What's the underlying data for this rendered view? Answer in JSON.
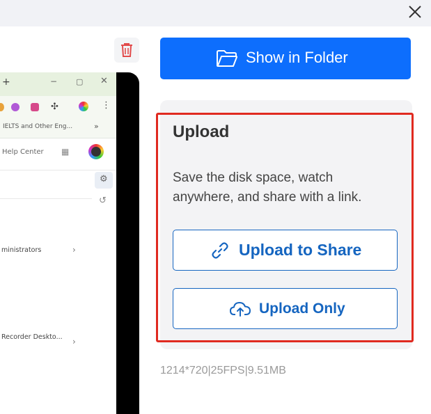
{
  "window": {
    "close_icon": "close-icon"
  },
  "preview": {
    "bookmark_text": "IELTS and Other Eng...",
    "bookmark_more": "»",
    "help_center": "Help Center",
    "list_item_1": "ministrators",
    "list_item_2": "Recorder Deskto...",
    "chevron": "›"
  },
  "actions": {
    "show_in_folder": "Show in Folder",
    "accent_color": "#0d6efd"
  },
  "upload": {
    "title": "Upload",
    "description": "Save the disk space, watch anywhere, and share with a link.",
    "share_button": "Upload to Share",
    "only_button": "Upload Only",
    "highlight_color": "#e02a20"
  },
  "video_meta": "1214*720|25FPS|9.51MB"
}
